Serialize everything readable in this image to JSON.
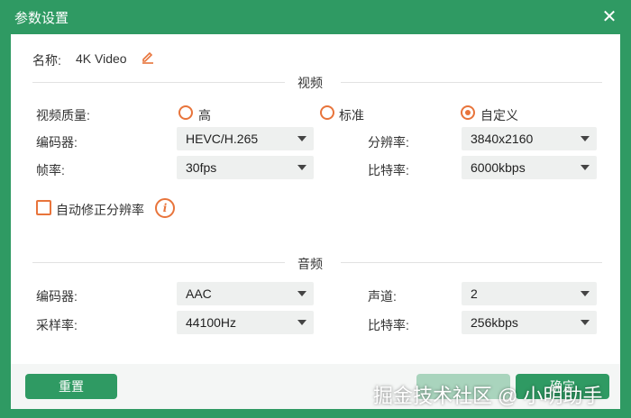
{
  "dialog": {
    "title": "参数设置",
    "close_icon": "close-icon"
  },
  "name": {
    "label": "名称:",
    "value": "4K Video",
    "edit_icon": "pencil-icon"
  },
  "video": {
    "section_title": "视频",
    "quality": {
      "label": "视频质量:",
      "options": [
        "高",
        "标准",
        "自定义"
      ],
      "selected": "自定义"
    },
    "encoder": {
      "label": "编码器:",
      "value": "HEVC/H.265"
    },
    "resolution": {
      "label": "分辨率:",
      "value": "3840x2160"
    },
    "framerate": {
      "label": "帧率:",
      "value": "30fps"
    },
    "bitrate": {
      "label": "比特率:",
      "value": "6000kbps"
    },
    "auto_fix": {
      "label": "自动修正分辨率",
      "checked": false,
      "info_icon": "info-icon"
    }
  },
  "audio": {
    "section_title": "音频",
    "encoder": {
      "label": "编码器:",
      "value": "AAC"
    },
    "channel": {
      "label": "声道:",
      "value": "2"
    },
    "samplerate": {
      "label": "采样率:",
      "value": "44100Hz"
    },
    "bitrate": {
      "label": "比特率:",
      "value": "256kbps"
    }
  },
  "footer": {
    "reset_label": "重置",
    "ok_label": "确定"
  },
  "watermark": "掘金技术社区 @ 小明助手",
  "colors": {
    "accent": "#2f9a63",
    "radio": "#e8743b",
    "panel": "#ffffff"
  }
}
